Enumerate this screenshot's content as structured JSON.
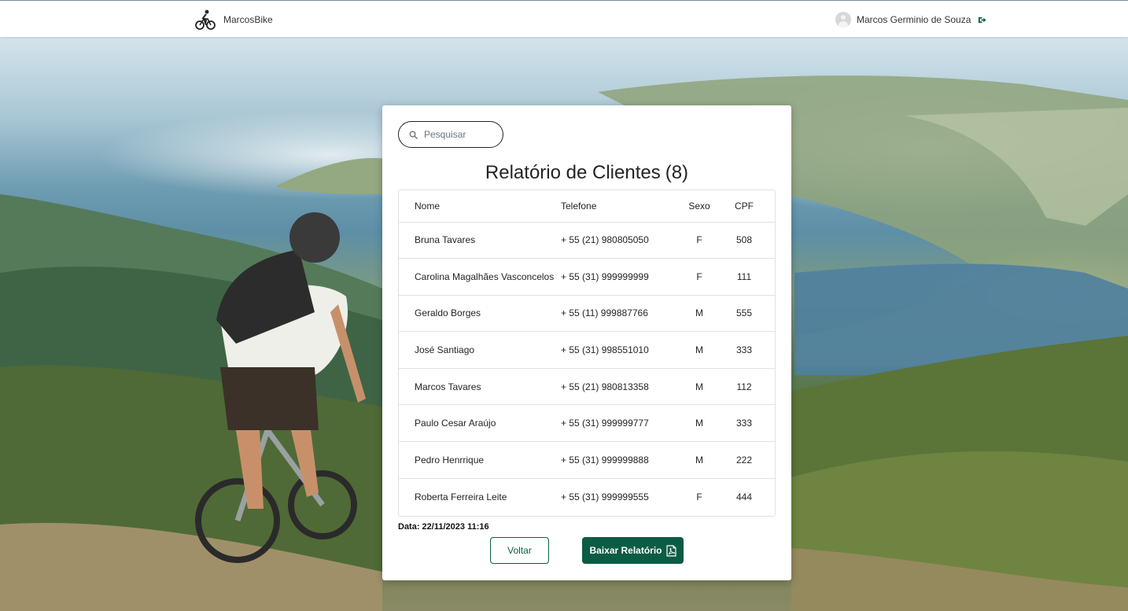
{
  "navbar": {
    "brand_name": "MarcosBike",
    "user_name": "Marcos Germinio de Souza"
  },
  "search": {
    "placeholder": "Pesquisar"
  },
  "report": {
    "title": "Relatório de Clientes",
    "count": "(8)",
    "columns": {
      "nome": "Nome",
      "telefone": "Telefone",
      "sexo": "Sexo",
      "cpf": "CPF"
    },
    "rows": [
      {
        "nome": "Bruna Tavares",
        "telefone": "+ 55 (21) 980805050",
        "sexo": "F",
        "cpf": "508"
      },
      {
        "nome": "Carolina Magalhães Vasconcelos",
        "telefone": "+ 55 (31) 999999999",
        "sexo": "F",
        "cpf": "111"
      },
      {
        "nome": "Geraldo Borges",
        "telefone": "+ 55 (11) 999887766",
        "sexo": "M",
        "cpf": "555"
      },
      {
        "nome": "José Santiago",
        "telefone": "+ 55 (31) 998551010",
        "sexo": "M",
        "cpf": "333"
      },
      {
        "nome": "Marcos Tavares",
        "telefone": "+ 55 (21) 980813358",
        "sexo": "M",
        "cpf": "112"
      },
      {
        "nome": "Paulo Cesar Araújo",
        "telefone": "+ 55 (31) 999999777",
        "sexo": "M",
        "cpf": "333"
      },
      {
        "nome": "Pedro Henrrique",
        "telefone": "+ 55 (31) 999999888",
        "sexo": "M",
        "cpf": "222"
      },
      {
        "nome": "Roberta Ferreira Leite",
        "telefone": "+ 55 (31) 999999555",
        "sexo": "F",
        "cpf": "444"
      }
    ],
    "date": "Data: 22/11/2023  11:16"
  },
  "actions": {
    "back_label": "Voltar",
    "download_label": "Baixar Relatório"
  },
  "icons": {
    "brand": "cyclist-icon",
    "avatar": "user-avatar-icon",
    "logout": "logout-icon",
    "search": "search-icon",
    "download": "pdf-file-icon"
  },
  "colors": {
    "primary": "#0b5c44",
    "card_bg": "#ffffff",
    "border": "#dee2e6"
  }
}
